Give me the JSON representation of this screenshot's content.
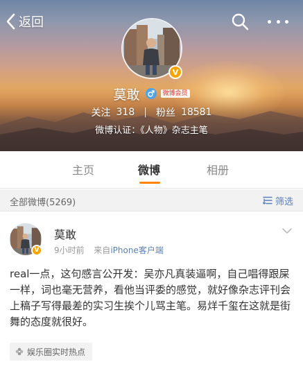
{
  "colors": {
    "accent_orange": "#ff8200",
    "link_blue": "#5b7fb8",
    "verified_badge": "#f7a400",
    "member_tag_red": "#e8322e"
  },
  "nav": {
    "back_label": "返回",
    "back_icon": "chevron-left-icon",
    "search_icon": "search-icon",
    "more_icon": "more-dots-icon"
  },
  "profile": {
    "name": "莫敢",
    "gender_icon": "male-icon",
    "member_tag": "微博会员",
    "verified_badge": "V",
    "following_label": "关注",
    "following_count": "318",
    "stat_separator": "|",
    "followers_label": "粉丝",
    "followers_count": "18581",
    "verification": "微博认证：《人物》杂志主笔"
  },
  "tabs": [
    {
      "label": "主页",
      "active": false
    },
    {
      "label": "微博",
      "active": true
    },
    {
      "label": "相册",
      "active": false
    }
  ],
  "filter_bar": {
    "all_label": "全部微博(5269)",
    "filter_label": "筛选",
    "filter_icon": "filter-icon"
  },
  "post": {
    "author": "莫敢",
    "verified_badge": "V",
    "time": "9小时前",
    "source_prefix": "来自",
    "source_link": "iPhone客户端",
    "expand_icon": "chevron-down-icon",
    "text": "real一点，这句感言公开发：吴亦凡真装逼啊，自己唱得跟屎一样，词也毫无营养，看他当评委的感觉，就好像杂志评刊会上稿子写得最差的实习生挨个儿骂主笔。易烊千玺在这就是街舞的态度就很好。",
    "topic_label": "娱乐圈实时热点",
    "topic_icon": "pinwheel-icon"
  }
}
